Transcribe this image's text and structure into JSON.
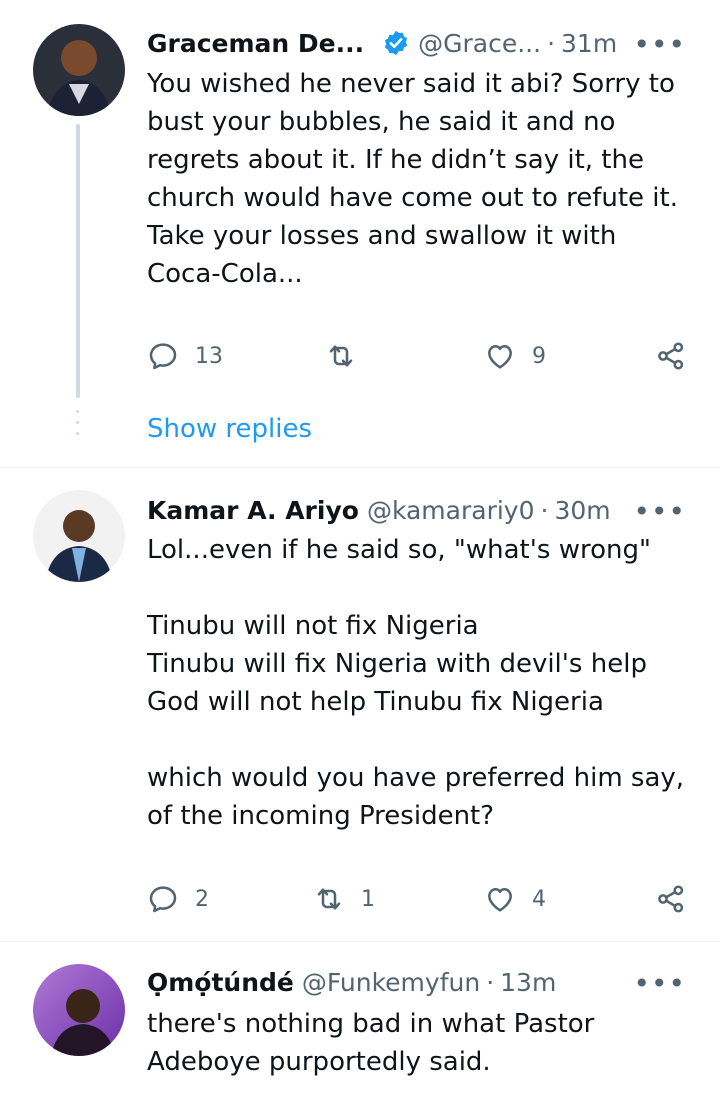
{
  "tweets": [
    {
      "name": "Graceman De...",
      "verified": true,
      "handle": "@Grace...",
      "time": "31m",
      "more": "•••",
      "text": "You wished he never said it abi? Sorry to bust your bubbles, he said it and no regrets about it. If he didn’t say it, the church would have come out to refute it. Take your losses and swallow it with Coca-Cola...",
      "reply_count": "13",
      "retweet_count": "",
      "like_count": "9"
    },
    {
      "name": "Kamar A. Ariyo",
      "verified": false,
      "handle": "@kamarariy0",
      "time": "30m",
      "more": "•••",
      "text": "Lol...even if he said so, \"what's wrong\"\n\nTinubu will not fix Nigeria\nTinubu will fix Nigeria with devil's help\nGod will not help Tinubu fix Nigeria\n\nwhich would you have preferred him say, of the incoming President?",
      "reply_count": "2",
      "retweet_count": "1",
      "like_count": "4"
    },
    {
      "name": "Ọmọ́túndé",
      "verified": false,
      "handle": "@Funkemyfun",
      "time": "13m",
      "more": "•••",
      "text": "there's nothing bad in what Pastor Adeboye purportedly said."
    }
  ],
  "show_replies_label": "Show replies",
  "colors": {
    "link": "#1d9bf0",
    "muted": "#536471",
    "divider": "#eff3f4",
    "thread_line": "#cfd9de"
  },
  "icons": [
    "reply-icon",
    "retweet-icon",
    "like-icon",
    "share-icon",
    "verified-badge-icon",
    "more-icon"
  ]
}
